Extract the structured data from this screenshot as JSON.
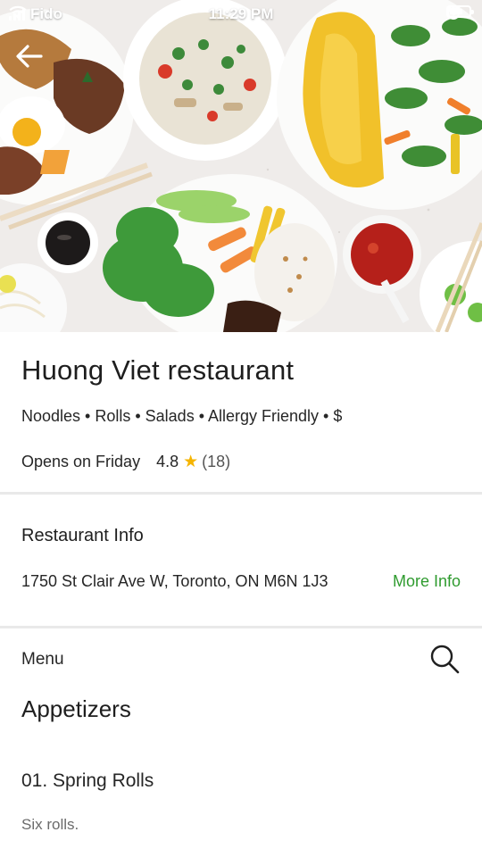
{
  "status_bar": {
    "carrier": "Fido",
    "time": "11:29 PM"
  },
  "icons": {
    "back": "back-arrow-icon",
    "search": "search-icon",
    "star": "star-icon",
    "wifi": "wifi-icon",
    "location": "location-arrow-icon",
    "alarm": "alarm-icon",
    "battery": "battery-icon"
  },
  "restaurant": {
    "name": "Huong Viet restaurant",
    "categories": "Noodles • Rolls • Salads • Allergy Friendly • $",
    "opening": "Opens on Friday",
    "rating": "4.8",
    "review_count": "(18)",
    "rating_color": "#f5b400"
  },
  "info": {
    "title": "Restaurant Info",
    "address": "1750 St Clair Ave W, Toronto, ON M6N 1J3",
    "more_label": "More Info",
    "link_color": "#2f9b2f"
  },
  "menu": {
    "label": "Menu",
    "category": "Appetizers",
    "items": [
      {
        "name": "01. Spring Rolls",
        "description": "Six rolls."
      }
    ]
  }
}
